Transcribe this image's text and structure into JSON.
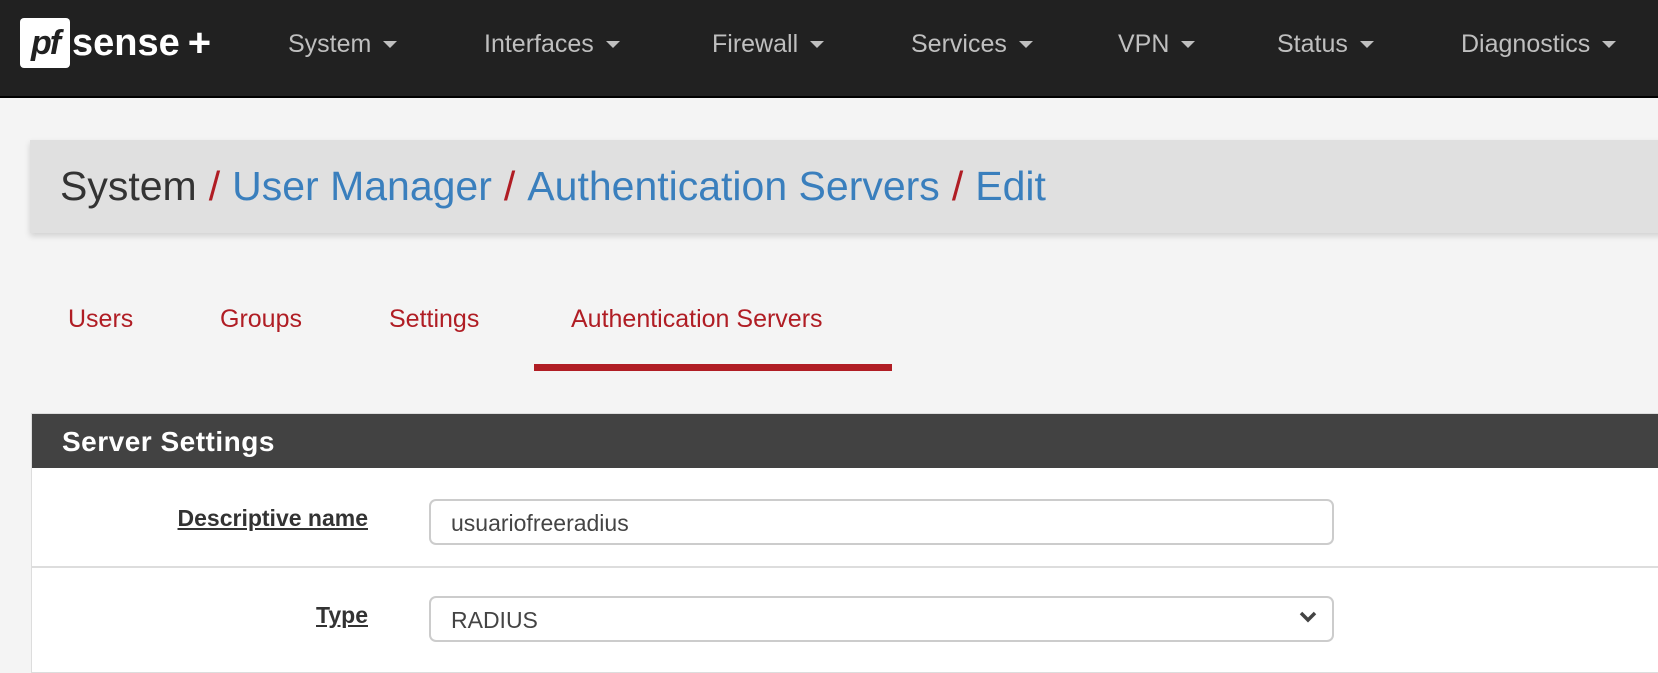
{
  "brand": {
    "logo_text": "pfsense+"
  },
  "nav": [
    {
      "label": "System"
    },
    {
      "label": "Interfaces"
    },
    {
      "label": "Firewall"
    },
    {
      "label": "Services"
    },
    {
      "label": "VPN"
    },
    {
      "label": "Status"
    },
    {
      "label": "Diagnostics"
    }
  ],
  "breadcrumb": {
    "items": [
      "System",
      "User Manager",
      "Authentication Servers",
      "Edit"
    ],
    "separator": "/"
  },
  "tabs": [
    {
      "label": "Users"
    },
    {
      "label": "Groups"
    },
    {
      "label": "Settings"
    },
    {
      "label": "Authentication Servers",
      "active": true
    }
  ],
  "panel": {
    "title": "Server Settings",
    "fields": [
      {
        "label": "Descriptive name",
        "value": "usuariofreeradius"
      },
      {
        "label": "Type",
        "value": "RADIUS"
      }
    ]
  },
  "colors": {
    "accent": "#b01d24",
    "link": "#3a7fbd",
    "navbar": "#212121",
    "panel_header": "#424242"
  }
}
